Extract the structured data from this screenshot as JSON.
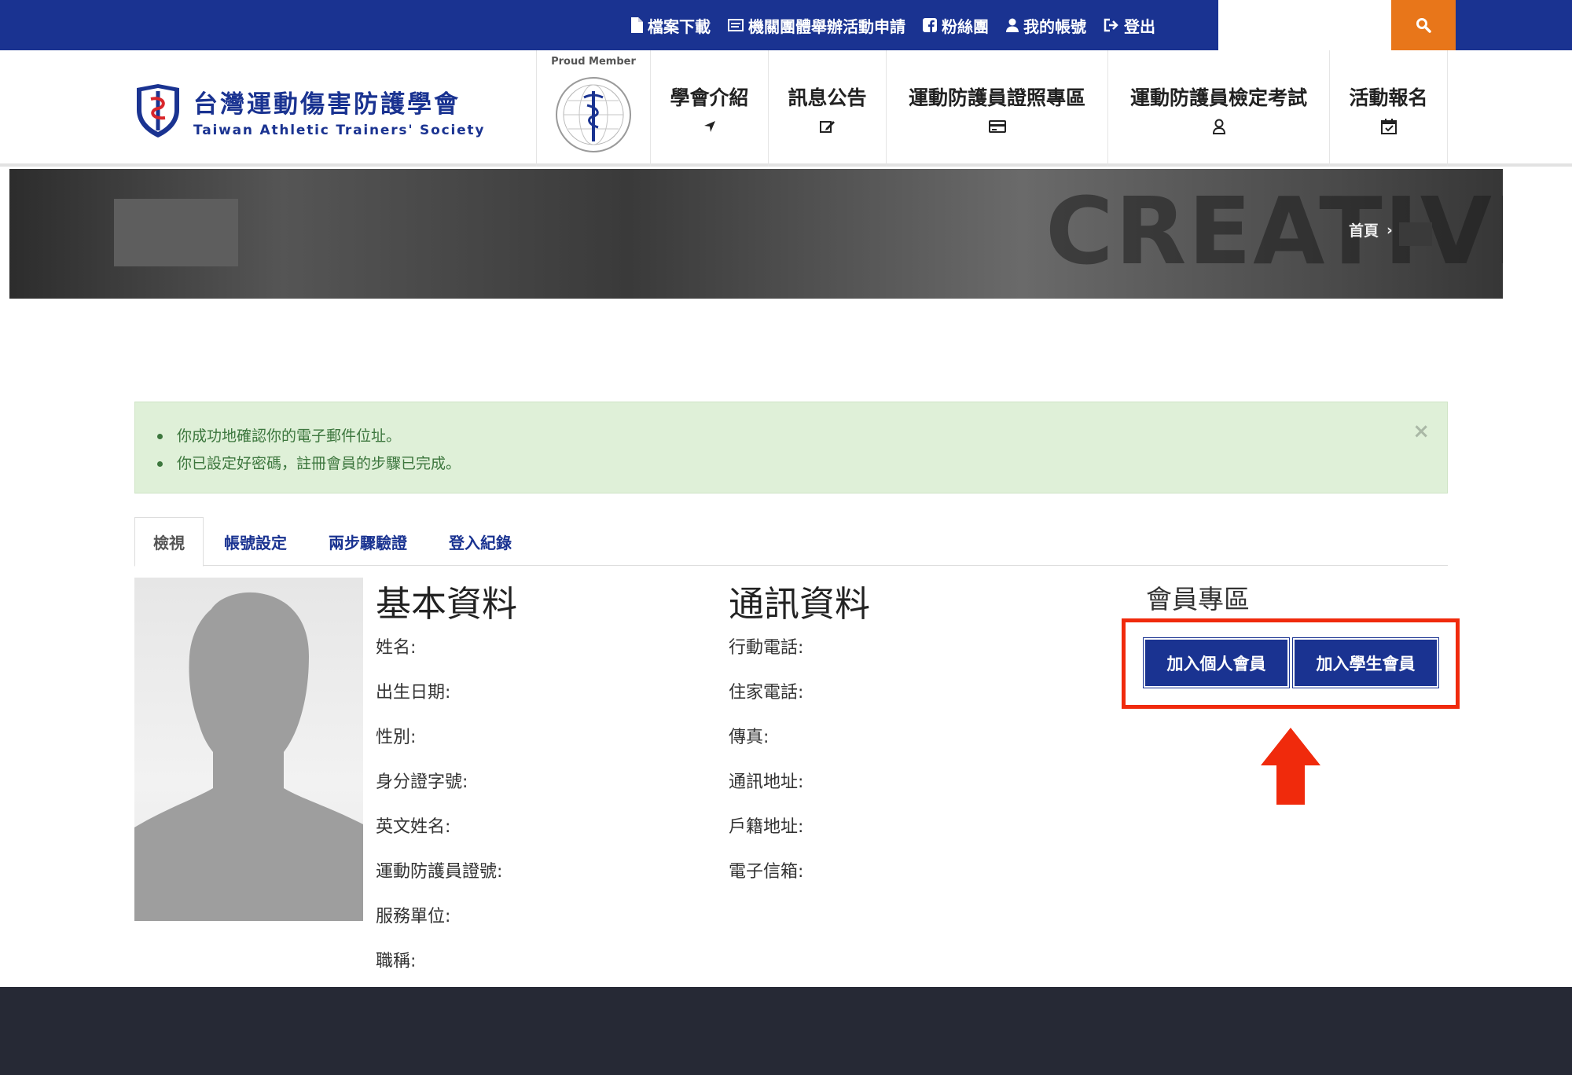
{
  "topbar": {
    "links": [
      {
        "label": "檔案下載",
        "icon": "file-icon"
      },
      {
        "label": "機關團體舉辦活動申請",
        "icon": "form-icon"
      },
      {
        "label": "粉絲團",
        "icon": "facebook-icon"
      },
      {
        "label": "我的帳號",
        "icon": "user-icon"
      },
      {
        "label": "登出",
        "icon": "logout-icon"
      }
    ],
    "search_icon": "search-icon"
  },
  "header": {
    "logo_zh": "台灣運動傷害防護學會",
    "logo_en": "Taiwan Athletic Trainers' Society",
    "proud_member": "Proud Member",
    "nav": [
      {
        "label": "學會介紹",
        "icon": "location-arrow-icon"
      },
      {
        "label": "訊息公告",
        "icon": "edit-icon"
      },
      {
        "label": "運動防護員證照專區",
        "icon": "card-icon"
      },
      {
        "label": "運動防護員檢定考試",
        "icon": "user-outline-icon"
      },
      {
        "label": "活動報名",
        "icon": "calendar-check-icon"
      }
    ]
  },
  "banner": {
    "text": "CREATIVE",
    "breadcrumb_home": "首頁",
    "breadcrumb_sep": "›"
  },
  "alert": {
    "messages": [
      "你成功地確認你的電子郵件位址。",
      "你已設定好密碼，註冊會員的步驟已完成。"
    ],
    "close": "×"
  },
  "tabs": [
    {
      "label": "檢視",
      "active": true
    },
    {
      "label": "帳號設定",
      "active": false
    },
    {
      "label": "兩步驟驗證",
      "active": false
    },
    {
      "label": "登入紀錄",
      "active": false
    }
  ],
  "basic": {
    "title": "基本資料",
    "fields": [
      "姓名:",
      "出生日期:",
      "性別:",
      "身分證字號:",
      "英文姓名:",
      "運動防護員證號:",
      "服務單位:",
      "職稱:"
    ]
  },
  "contact": {
    "title": "通訊資料",
    "fields": [
      "行動電話:",
      "住家電話:",
      "傳真:",
      "通訊地址:",
      "戶籍地址:",
      "電子信箱:"
    ]
  },
  "member_zone": {
    "title": "會員專區",
    "buttons": [
      "加入個人會員",
      "加入學生會員"
    ]
  },
  "colors": {
    "brand": "#1a3391",
    "search": "#e8761a",
    "highlight": "#f02a0c",
    "alert_bg": "#dff0d8",
    "footer": "#262935"
  }
}
